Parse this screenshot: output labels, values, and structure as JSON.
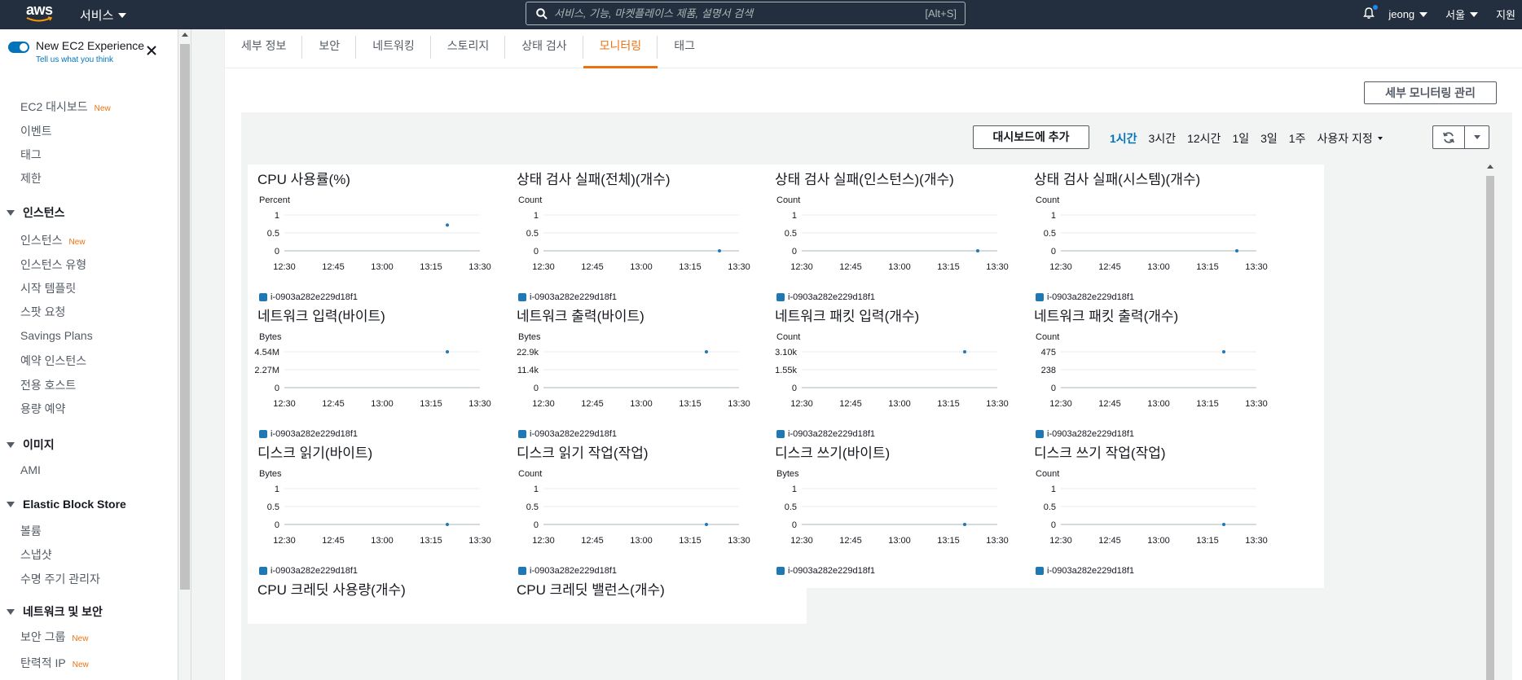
{
  "topbar": {
    "logo_text": "aws",
    "services_label": "서비스",
    "search_placeholder": "서비스, 기능, 마켓플레이스 제품, 설명서 검색",
    "search_shortcut": "[Alt+S]",
    "user": "jeong",
    "region": "서울",
    "support": "지원"
  },
  "sidebar": {
    "toggle_label": "New EC2 Experience",
    "toggle_sub": "Tell us what you think",
    "new_badge": "New",
    "items": [
      {
        "label": "EC2 대시보드",
        "new": true,
        "type": "item"
      },
      {
        "label": "이벤트",
        "new": false,
        "type": "item"
      },
      {
        "label": "태그",
        "new": false,
        "type": "item"
      },
      {
        "label": "제한",
        "new": false,
        "type": "item"
      },
      {
        "label": "인스턴스",
        "type": "section"
      },
      {
        "label": "인스턴스",
        "new": true,
        "type": "item"
      },
      {
        "label": "인스턴스 유형",
        "new": false,
        "type": "item"
      },
      {
        "label": "시작 템플릿",
        "new": false,
        "type": "item"
      },
      {
        "label": "스팟 요청",
        "new": false,
        "type": "item"
      },
      {
        "label": "Savings Plans",
        "new": false,
        "type": "item"
      },
      {
        "label": "예약 인스턴스",
        "new": false,
        "type": "item"
      },
      {
        "label": "전용 호스트",
        "new": false,
        "type": "item"
      },
      {
        "label": "용량 예약",
        "new": false,
        "type": "item"
      },
      {
        "label": "이미지",
        "type": "section"
      },
      {
        "label": "AMI",
        "new": false,
        "type": "item"
      },
      {
        "label": "Elastic Block Store",
        "type": "section"
      },
      {
        "label": "볼륨",
        "new": false,
        "type": "item"
      },
      {
        "label": "스냅샷",
        "new": false,
        "type": "item"
      },
      {
        "label": "수명 주기 관리자",
        "new": false,
        "type": "item"
      },
      {
        "label": "네트워크 및 보안",
        "type": "section"
      },
      {
        "label": "보안 그룹",
        "new": true,
        "type": "item"
      },
      {
        "label": "탄력적 IP",
        "new": true,
        "type": "item"
      },
      {
        "label": "배치 그룹",
        "new": false,
        "type": "item"
      }
    ]
  },
  "tabs": [
    "세부 정보",
    "보안",
    "네트워킹",
    "스토리지",
    "상태 검사",
    "모니터링",
    "태그"
  ],
  "active_tab": "모니터링",
  "monitoring": {
    "manage_button": "세부 모니터링 관리",
    "add_dashboard_button": "대시보드에 추가",
    "ranges": [
      "1시간",
      "3시간",
      "12시간",
      "1일",
      "3일",
      "1주"
    ],
    "active_range": "1시간",
    "custom_range": "사용자 지정",
    "x_ticks": [
      "12:30",
      "12:45",
      "13:00",
      "13:15",
      "13:30"
    ],
    "legend_label": "i-0903a282e229d18f1",
    "series_color": "#1f77b4"
  },
  "chart_data": [
    {
      "type": "scatter",
      "title": "CPU 사용률(%)",
      "ylabel": "Percent",
      "y_ticks": [
        "1",
        "0.5",
        "0"
      ],
      "ylim": [
        0,
        1
      ],
      "x": [
        "13:20"
      ],
      "values": [
        0.72
      ]
    },
    {
      "type": "scatter",
      "title": "상태 검사 실패(전체)(개수)",
      "ylabel": "Count",
      "y_ticks": [
        "1",
        "0.5",
        "0"
      ],
      "ylim": [
        0,
        1
      ],
      "x": [
        "13:24"
      ],
      "values": [
        0
      ]
    },
    {
      "type": "scatter",
      "title": "상태 검사 실패(인스턴스)(개수)",
      "ylabel": "Count",
      "y_ticks": [
        "1",
        "0.5",
        "0"
      ],
      "ylim": [
        0,
        1
      ],
      "x": [
        "13:24"
      ],
      "values": [
        0
      ]
    },
    {
      "type": "scatter",
      "title": "상태 검사 실패(시스템)(개수)",
      "ylabel": "Count",
      "y_ticks": [
        "1",
        "0.5",
        "0"
      ],
      "ylim": [
        0,
        1
      ],
      "x": [
        "13:24"
      ],
      "values": [
        0
      ]
    },
    {
      "type": "scatter",
      "title": "네트워크 입력(바이트)",
      "ylabel": "Bytes",
      "y_ticks": [
        "4.54M",
        "2.27M",
        "0"
      ],
      "ylim": [
        0,
        4540000
      ],
      "x": [
        "13:20"
      ],
      "values": [
        4540000
      ]
    },
    {
      "type": "scatter",
      "title": "네트워크 출력(바이트)",
      "ylabel": "Bytes",
      "y_ticks": [
        "22.9k",
        "11.4k",
        "0"
      ],
      "ylim": [
        0,
        22900
      ],
      "x": [
        "13:20"
      ],
      "values": [
        22900
      ]
    },
    {
      "type": "scatter",
      "title": "네트워크 패킷 입력(개수)",
      "ylabel": "Count",
      "y_ticks": [
        "3.10k",
        "1.55k",
        "0"
      ],
      "ylim": [
        0,
        3100
      ],
      "x": [
        "13:20"
      ],
      "values": [
        3100
      ]
    },
    {
      "type": "scatter",
      "title": "네트워크 패킷 출력(개수)",
      "ylabel": "Count",
      "y_ticks": [
        "475",
        "238",
        "0"
      ],
      "ylim": [
        0,
        475
      ],
      "x": [
        "13:20"
      ],
      "values": [
        475
      ]
    },
    {
      "type": "scatter",
      "title": "디스크 읽기(바이트)",
      "ylabel": "Bytes",
      "y_ticks": [
        "1",
        "0.5",
        "0"
      ],
      "ylim": [
        0,
        1
      ],
      "x": [
        "13:20"
      ],
      "values": [
        0
      ]
    },
    {
      "type": "scatter",
      "title": "디스크 읽기 작업(작업)",
      "ylabel": "Count",
      "y_ticks": [
        "1",
        "0.5",
        "0"
      ],
      "ylim": [
        0,
        1
      ],
      "x": [
        "13:20"
      ],
      "values": [
        0
      ]
    },
    {
      "type": "scatter",
      "title": "디스크 쓰기(바이트)",
      "ylabel": "Bytes",
      "y_ticks": [
        "1",
        "0.5",
        "0"
      ],
      "ylim": [
        0,
        1
      ],
      "x": [
        "13:20"
      ],
      "values": [
        0
      ]
    },
    {
      "type": "scatter",
      "title": "디스크 쓰기 작업(작업)",
      "ylabel": "Count",
      "y_ticks": [
        "1",
        "0.5",
        "0"
      ],
      "ylim": [
        0,
        1
      ],
      "x": [
        "13:20"
      ],
      "values": [
        0
      ]
    },
    {
      "type": "scatter",
      "title": "CPU 크레딧 사용량(개수)"
    },
    {
      "type": "scatter",
      "title": "CPU 크레딧 밸런스(개수)"
    }
  ]
}
